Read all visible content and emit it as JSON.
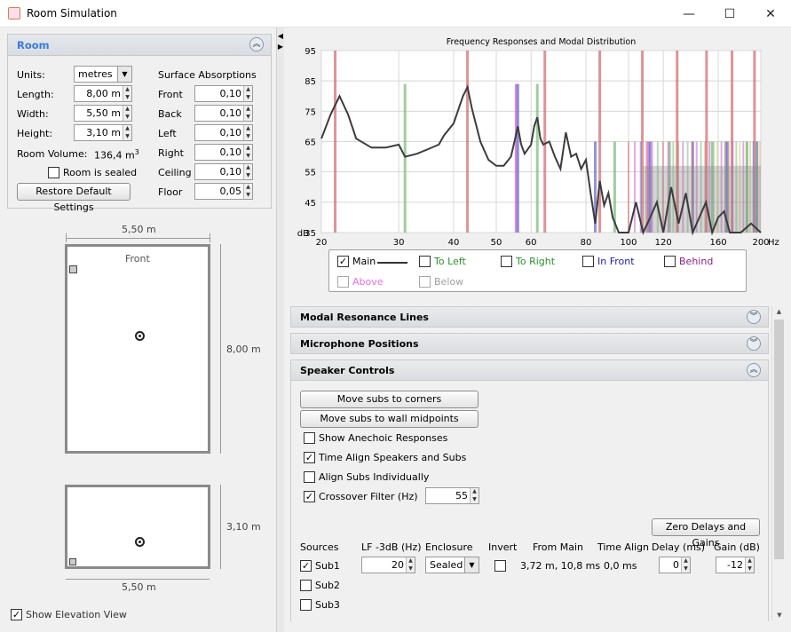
{
  "window": {
    "title": "Room Simulation",
    "minimize": "—",
    "maximize": "☐",
    "close": "✕"
  },
  "room": {
    "header": "Room",
    "units_label": "Units:",
    "units_value": "metres",
    "length_label": "Length:",
    "length": "8,00 m",
    "width_label": "Width:",
    "width": "5,50 m",
    "height_label": "Height:",
    "height": "3,10 m",
    "volume_label": "Room Volume:",
    "volume": "136,4 m",
    "volume_sup": "3",
    "sealed_label": "Room is sealed",
    "restore_button": "Restore Default Settings",
    "surface_title": "Surface Absorptions",
    "surfaces": [
      {
        "label": "Front",
        "value": "0,10"
      },
      {
        "label": "Back",
        "value": "0,10"
      },
      {
        "label": "Left",
        "value": "0,10"
      },
      {
        "label": "Right",
        "value": "0,10"
      },
      {
        "label": "Ceiling",
        "value": "0,10"
      },
      {
        "label": "Floor",
        "value": "0,05"
      }
    ]
  },
  "plan": {
    "top_width": "5,50 m",
    "front_label": "Front",
    "length": "8,00 m",
    "elev_height": "3,10 m",
    "bottom_width": "5,50 m"
  },
  "elevation": {
    "label": "Show Elevation View",
    "checked": true
  },
  "chart_data": {
    "type": "line",
    "title": "Frequency Responses and Modal Distribution",
    "ylabel": "dB",
    "xlabel": "Hz",
    "y_ticks": [
      35,
      45,
      55,
      65,
      75,
      85,
      95
    ],
    "x_ticks": [
      20,
      30,
      40,
      50,
      60,
      80,
      100,
      120,
      160,
      200
    ],
    "ylim": [
      35,
      95
    ],
    "xlim": [
      20,
      200
    ],
    "x_scale": "log",
    "series": [
      {
        "name": "Main",
        "color": "#3c3c3c",
        "x": [
          20,
          21,
          22,
          23,
          24,
          26,
          28,
          29,
          30,
          31,
          33,
          35,
          37,
          38,
          40,
          42,
          43,
          44,
          46,
          48,
          50,
          52,
          54,
          55,
          56,
          57,
          58,
          60,
          61,
          62,
          63,
          64,
          66,
          68,
          70,
          72,
          74,
          76,
          78,
          80,
          82,
          84,
          86,
          88,
          90,
          92,
          95,
          100,
          104,
          108,
          112,
          116,
          120,
          125,
          130,
          135,
          140,
          150,
          155,
          160,
          165,
          170,
          180,
          190,
          200
        ],
        "y": [
          66,
          74,
          80,
          74,
          66,
          63,
          63,
          63.5,
          64,
          60,
          61,
          62.5,
          64,
          67,
          71,
          80,
          83,
          76,
          65,
          59,
          57,
          57,
          60,
          65,
          70,
          64,
          61,
          64,
          70,
          73,
          66,
          64,
          65,
          60,
          56,
          68,
          60,
          61,
          56,
          59,
          48,
          38,
          52,
          44,
          48,
          40,
          35,
          35,
          45,
          32,
          40,
          45,
          35,
          50,
          38,
          48,
          32,
          45,
          33,
          40,
          42,
          30,
          35,
          38,
          28
        ]
      },
      {
        "name": "Front",
        "color": "#d47070",
        "lines": [
          21.5,
          43,
          64.5,
          86,
          107.5,
          129,
          150.5,
          172,
          193.5
        ]
      },
      {
        "name": "Left",
        "color": "#7dbf7d",
        "lines": [
          31,
          62,
          93,
          124,
          155,
          186
        ]
      },
      {
        "name": "Above",
        "color": "#cc66cc",
        "lines": [
          55.5,
          111,
          166.5
        ]
      },
      {
        "name": "In Front",
        "color": "#7070cc",
        "lines": [
          56,
          84,
          112,
          140,
          168,
          196
        ]
      }
    ],
    "legend": [
      {
        "label": "Main",
        "checked": true,
        "color": "#000000"
      },
      {
        "label": "To Left",
        "checked": false,
        "color": "#2f8f2f"
      },
      {
        "label": "To Right",
        "checked": false,
        "color": "#2f8f2f"
      },
      {
        "label": "In Front",
        "checked": false,
        "color": "#2020a0"
      },
      {
        "label": "Behind",
        "checked": false,
        "color": "#8a2080"
      },
      {
        "label": "Above",
        "checked": false,
        "color": "#e070e0"
      },
      {
        "label": "Below",
        "checked": false,
        "color": "#a0a0a0"
      }
    ]
  },
  "sections": {
    "modal": "Modal Resonance Lines",
    "mic": "Microphone Positions",
    "speaker": "Speaker Controls"
  },
  "speaker": {
    "move_corners": "Move subs to corners",
    "move_mid": "Move subs to wall midpoints",
    "anechoic": "Show Anechoic Responses",
    "time_align": "Time Align Speakers and Subs",
    "align_subs": "Align Subs Individually",
    "crossover": "Crossover Filter (Hz)",
    "crossover_value": "55",
    "zero_button": "Zero Delays and Gains",
    "headers": [
      "Sources",
      "LF -3dB (Hz)",
      "Enclosure",
      "Invert",
      "From Main",
      "Time Align",
      "Delay (ms)",
      "Gain (dB)"
    ],
    "sub1": {
      "label": "Sub1",
      "lf": "20",
      "enclosure": "Sealed",
      "from_main": "3,72 m, 10,8 ms",
      "time_align": "0,0 ms",
      "delay": "0",
      "gain": "-12"
    },
    "sub2": "Sub2",
    "sub3": "Sub3"
  }
}
